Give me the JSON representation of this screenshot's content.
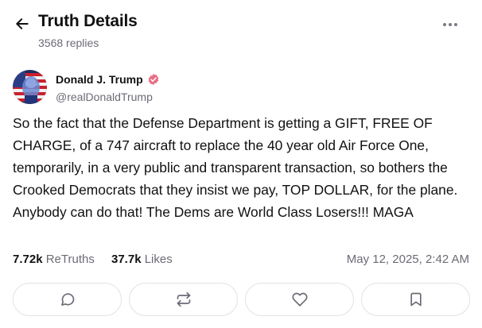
{
  "header": {
    "back_icon": "arrow-left-icon",
    "title": "Truth Details",
    "subtitle": "3568 replies",
    "more_icon": "more-horizontal-icon"
  },
  "author": {
    "name": "Donald J. Trump",
    "handle": "@realDonaldTrump",
    "verified_icon": "verified-badge-icon",
    "verified_color": "#e96e86"
  },
  "post": {
    "text": "So the fact that the Defense Department is getting a GIFT, FREE OF CHARGE, of a 747 aircraft to replace the 40 year old Air Force One, temporarily, in a very public and transparent transaction, so bothers the Crooked Democrats that they insist we pay, TOP DOLLAR, for the plane. Anybody can do that! The Dems are World Class Losers!!! MAGA"
  },
  "stats": {
    "retruths_count": "7.72k",
    "retruths_label": "ReTruths",
    "likes_count": "37.7k",
    "likes_label": "Likes",
    "timestamp": "May 12, 2025, 2:42 AM"
  },
  "actions": [
    {
      "icon": "reply-icon"
    },
    {
      "icon": "retruth-icon"
    },
    {
      "icon": "like-heart-icon"
    },
    {
      "icon": "bookmark-icon"
    }
  ],
  "colors": {
    "text": "#111111",
    "muted": "#6b6b76",
    "border": "#e2e2e8",
    "icon": "#6b6b76"
  }
}
